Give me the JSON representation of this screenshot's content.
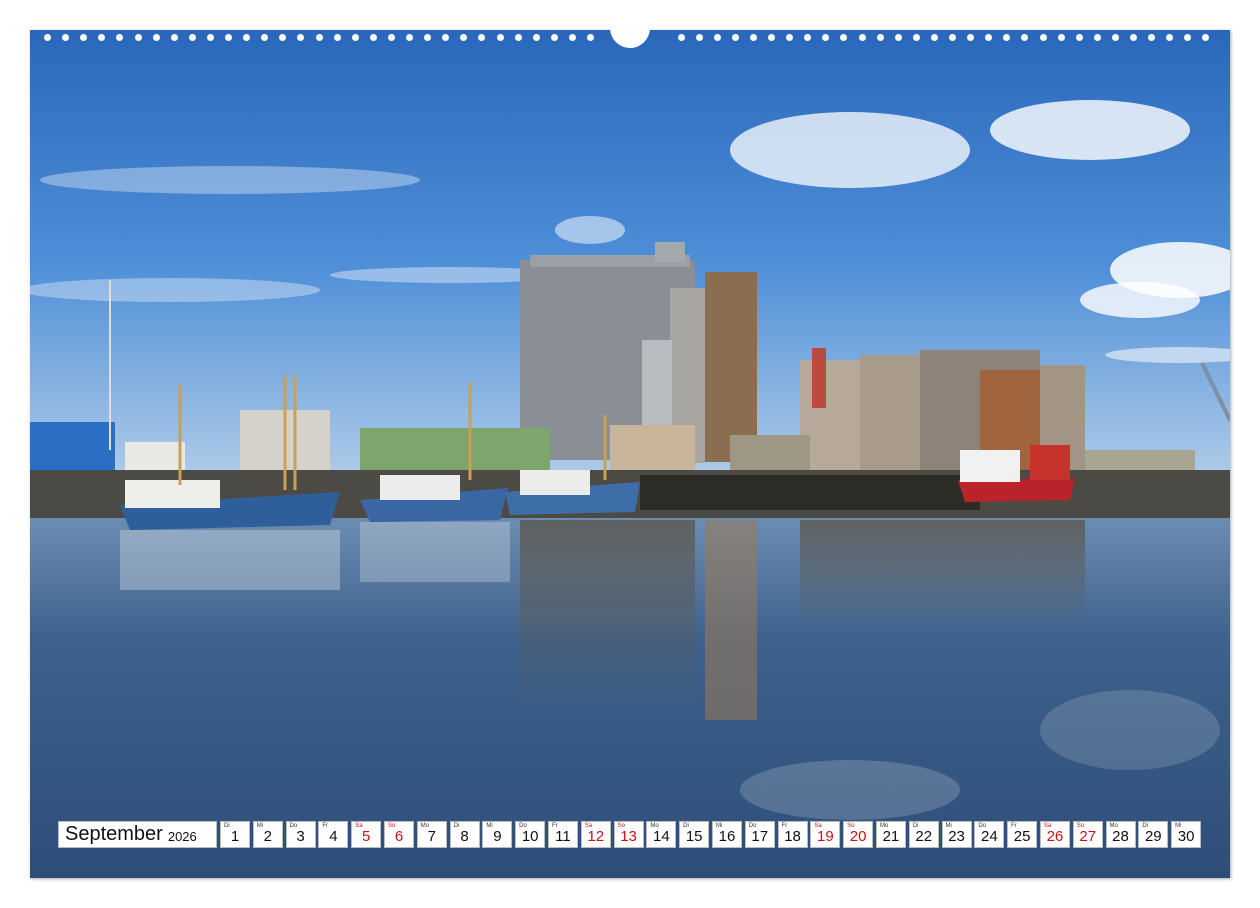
{
  "calendar": {
    "month": "September",
    "year": "2026",
    "days": [
      {
        "dow": "Di",
        "num": "1",
        "weekend": false
      },
      {
        "dow": "Mi",
        "num": "2",
        "weekend": false
      },
      {
        "dow": "Do",
        "num": "3",
        "weekend": false
      },
      {
        "dow": "Fr",
        "num": "4",
        "weekend": false
      },
      {
        "dow": "Sa",
        "num": "5",
        "weekend": true
      },
      {
        "dow": "So",
        "num": "6",
        "weekend": true
      },
      {
        "dow": "Mo",
        "num": "7",
        "weekend": false
      },
      {
        "dow": "Di",
        "num": "8",
        "weekend": false
      },
      {
        "dow": "Mi",
        "num": "9",
        "weekend": false
      },
      {
        "dow": "Do",
        "num": "10",
        "weekend": false
      },
      {
        "dow": "Fr",
        "num": "11",
        "weekend": false
      },
      {
        "dow": "Sa",
        "num": "12",
        "weekend": true
      },
      {
        "dow": "So",
        "num": "13",
        "weekend": true
      },
      {
        "dow": "Mo",
        "num": "14",
        "weekend": false
      },
      {
        "dow": "Di",
        "num": "15",
        "weekend": false
      },
      {
        "dow": "Mi",
        "num": "16",
        "weekend": false
      },
      {
        "dow": "Do",
        "num": "17",
        "weekend": false
      },
      {
        "dow": "Fr",
        "num": "18",
        "weekend": false
      },
      {
        "dow": "Sa",
        "num": "19",
        "weekend": true
      },
      {
        "dow": "So",
        "num": "20",
        "weekend": true
      },
      {
        "dow": "Mo",
        "num": "21",
        "weekend": false
      },
      {
        "dow": "Di",
        "num": "22",
        "weekend": false
      },
      {
        "dow": "Mi",
        "num": "23",
        "weekend": false
      },
      {
        "dow": "Do",
        "num": "24",
        "weekend": false
      },
      {
        "dow": "Fr",
        "num": "25",
        "weekend": false
      },
      {
        "dow": "Sa",
        "num": "26",
        "weekend": true
      },
      {
        "dow": "So",
        "num": "27",
        "weekend": true
      },
      {
        "dow": "Mo",
        "num": "28",
        "weekend": false
      },
      {
        "dow": "Di",
        "num": "29",
        "weekend": false
      },
      {
        "dow": "Mi",
        "num": "30",
        "weekend": false
      }
    ]
  },
  "colors": {
    "weekend": "#cc1111",
    "sky_top": "#2f6fc0",
    "water": "#3d5f86"
  },
  "photo": {
    "subject": "harbor-with-fishing-boats-and-grain-silos"
  }
}
